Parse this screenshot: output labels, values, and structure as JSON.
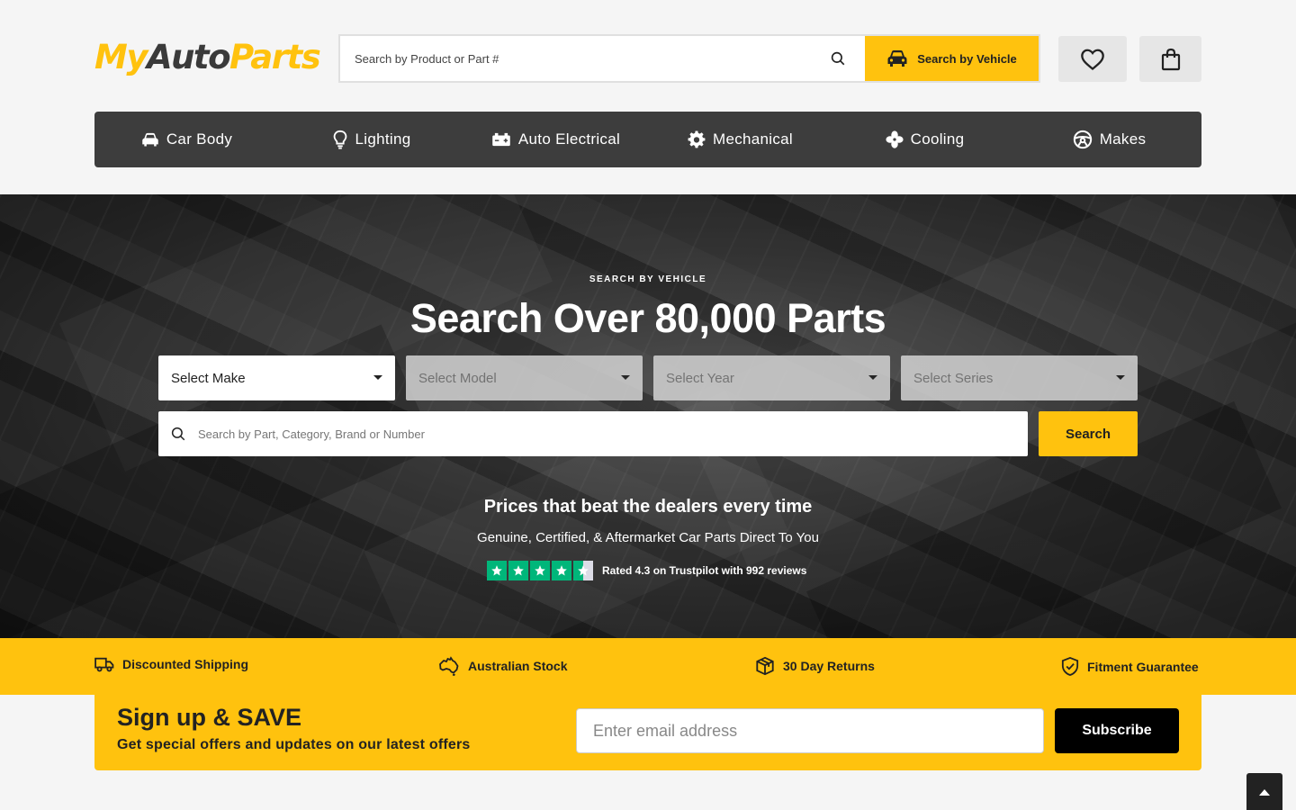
{
  "brand": {
    "logo_part1": "My",
    "logo_part2": "Auto",
    "logo_part3": "Parts"
  },
  "header": {
    "search_placeholder": "Search by Product or Part #",
    "vehicle_button_label": "Search by Vehicle",
    "wishlist_icon": "heart-icon",
    "cart_icon": "shopping-bag-icon"
  },
  "nav": {
    "items": [
      {
        "label": "Car Body",
        "icon": "car-icon"
      },
      {
        "label": "Lighting",
        "icon": "bulb-icon"
      },
      {
        "label": "Auto Electrical",
        "icon": "battery-icon"
      },
      {
        "label": "Mechanical",
        "icon": "gear-icon"
      },
      {
        "label": "Cooling",
        "icon": "fan-icon"
      },
      {
        "label": "Makes",
        "icon": "steering-wheel-icon"
      }
    ]
  },
  "hero": {
    "eyebrow": "SEARCH BY VEHICLE",
    "title": "Search Over 80,000 Parts",
    "selects": {
      "make": "Select Make",
      "model": "Select Model",
      "year": "Select Year",
      "series": "Select Series"
    },
    "part_search_placeholder": "Search by Part, Category, Brand or Number",
    "search_button_label": "Search",
    "tagline": "Prices that beat the dealers every time",
    "subtagline": "Genuine, Certified, & Aftermarket Car Parts Direct To You",
    "rating": {
      "stars": 4.5,
      "text": "Rated 4.3 on Trustpilot with 992 reviews"
    }
  },
  "features": [
    {
      "label": "Discounted Shipping",
      "icon": "truck-icon"
    },
    {
      "label": "Australian Stock",
      "icon": "australia-icon"
    },
    {
      "label": "30 Day Returns",
      "icon": "box-icon"
    },
    {
      "label": "Fitment Guarantee",
      "icon": "shield-check-icon"
    }
  ],
  "signup": {
    "title": "Sign up & SAVE",
    "subtitle": "Get special offers and updates on our latest offers",
    "email_placeholder": "Enter email address",
    "button_label": "Subscribe"
  },
  "colors": {
    "accent": "#ffc20e",
    "nav_bg": "#3d3d3d",
    "trustpilot": "#00b67a"
  }
}
